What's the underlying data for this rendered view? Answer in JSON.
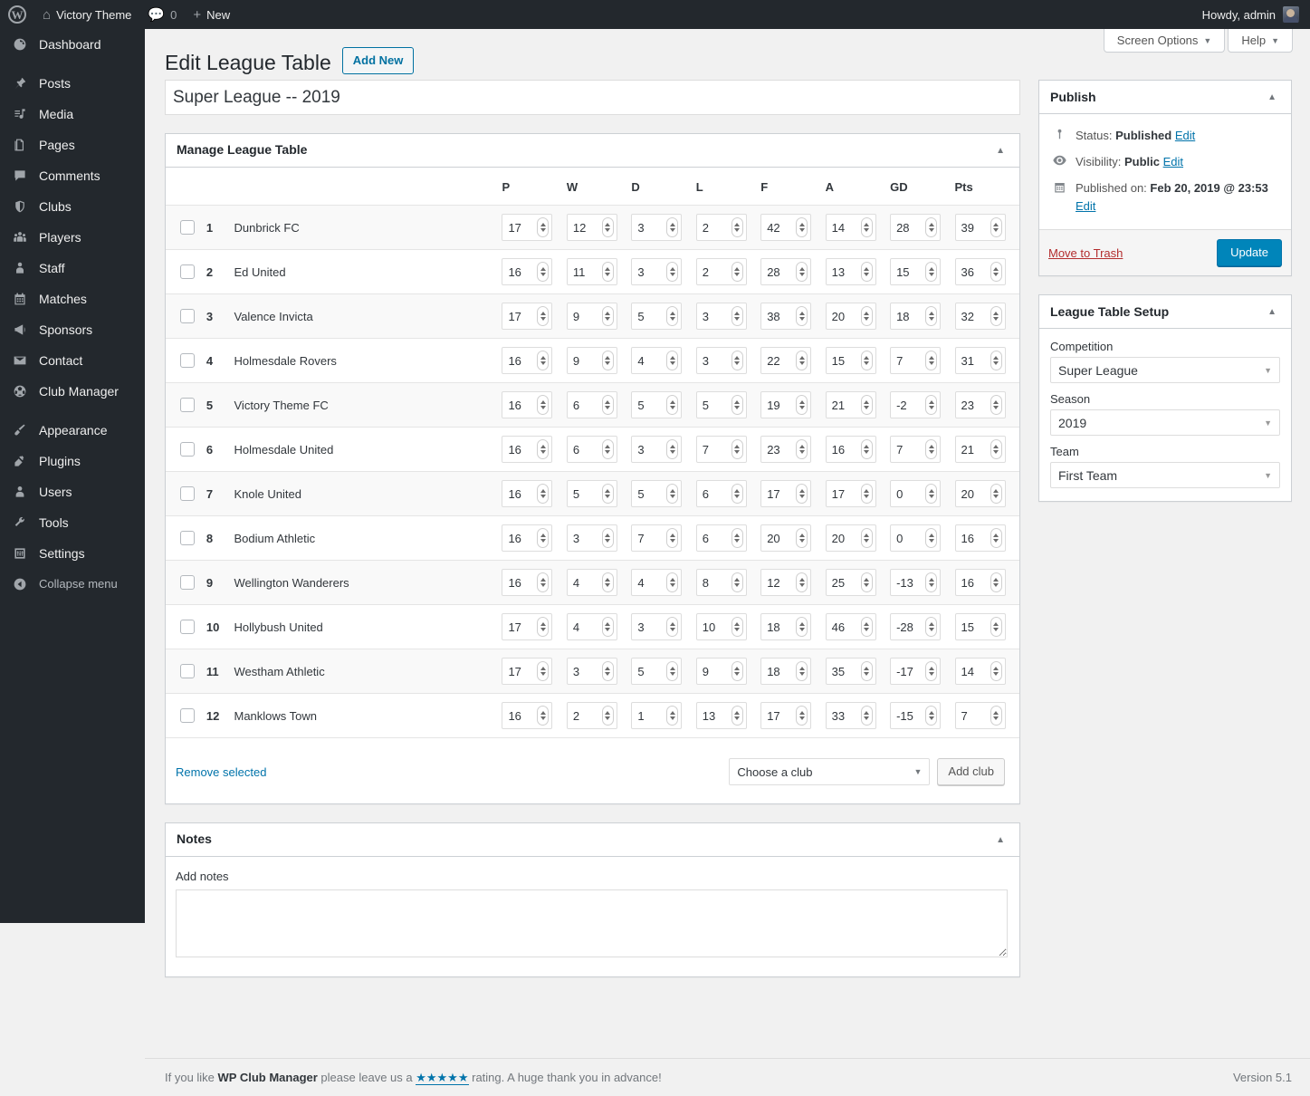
{
  "adminbar": {
    "wp_logo": "wordpress-logo-icon",
    "site_name": "Victory Theme",
    "comments_count": "0",
    "new_label": "New",
    "howdy": "Howdy, admin"
  },
  "sidebar": {
    "items": [
      {
        "label": "Dashboard",
        "icon": "dashboard-icon"
      },
      {
        "label": "Posts",
        "icon": "pin-icon"
      },
      {
        "label": "Media",
        "icon": "media-icon"
      },
      {
        "label": "Pages",
        "icon": "pages-icon"
      },
      {
        "label": "Comments",
        "icon": "comment-icon"
      },
      {
        "label": "Clubs",
        "icon": "shield-icon"
      },
      {
        "label": "Players",
        "icon": "players-icon"
      },
      {
        "label": "Staff",
        "icon": "staff-icon"
      },
      {
        "label": "Matches",
        "icon": "calendar-icon"
      },
      {
        "label": "Sponsors",
        "icon": "megaphone-icon"
      },
      {
        "label": "Contact",
        "icon": "envelope-icon"
      },
      {
        "label": "Club Manager",
        "icon": "football-icon"
      },
      {
        "label": "Appearance",
        "icon": "brush-icon"
      },
      {
        "label": "Plugins",
        "icon": "plug-icon"
      },
      {
        "label": "Users",
        "icon": "user-icon"
      },
      {
        "label": "Tools",
        "icon": "wrench-icon"
      },
      {
        "label": "Settings",
        "icon": "settings-icon"
      }
    ],
    "collapse_label": "Collapse menu"
  },
  "screen_meta": {
    "screen_options": "Screen Options",
    "help": "Help"
  },
  "page": {
    "title": "Edit League Table",
    "add_new": "Add New",
    "post_title_value": "Super League -- 2019",
    "post_title_placeholder": "Enter title here"
  },
  "manage_box": {
    "heading": "Manage League Table",
    "columns": [
      "P",
      "W",
      "D",
      "L",
      "F",
      "A",
      "GD",
      "Pts"
    ],
    "rows": [
      {
        "pos": "1",
        "club": "Dunbrick FC",
        "stats": [
          "17",
          "12",
          "3",
          "2",
          "42",
          "14",
          "28",
          "39"
        ]
      },
      {
        "pos": "2",
        "club": "Ed United",
        "stats": [
          "16",
          "11",
          "3",
          "2",
          "28",
          "13",
          "15",
          "36"
        ]
      },
      {
        "pos": "3",
        "club": "Valence Invicta",
        "stats": [
          "17",
          "9",
          "5",
          "3",
          "38",
          "20",
          "18",
          "32"
        ]
      },
      {
        "pos": "4",
        "club": "Holmesdale Rovers",
        "stats": [
          "16",
          "9",
          "4",
          "3",
          "22",
          "15",
          "7",
          "31"
        ]
      },
      {
        "pos": "5",
        "club": "Victory Theme FC",
        "stats": [
          "16",
          "6",
          "5",
          "5",
          "19",
          "21",
          "-2",
          "23"
        ]
      },
      {
        "pos": "6",
        "club": "Holmesdale United",
        "stats": [
          "16",
          "6",
          "3",
          "7",
          "23",
          "16",
          "7",
          "21"
        ]
      },
      {
        "pos": "7",
        "club": "Knole United",
        "stats": [
          "16",
          "5",
          "5",
          "6",
          "17",
          "17",
          "0",
          "20"
        ]
      },
      {
        "pos": "8",
        "club": "Bodium Athletic",
        "stats": [
          "16",
          "3",
          "7",
          "6",
          "20",
          "20",
          "0",
          "16"
        ]
      },
      {
        "pos": "9",
        "club": "Wellington Wanderers",
        "stats": [
          "16",
          "4",
          "4",
          "8",
          "12",
          "25",
          "-13",
          "16"
        ]
      },
      {
        "pos": "10",
        "club": "Hollybush United",
        "stats": [
          "17",
          "4",
          "3",
          "10",
          "18",
          "46",
          "-28",
          "15"
        ]
      },
      {
        "pos": "11",
        "club": "Westham Athletic",
        "stats": [
          "17",
          "3",
          "5",
          "9",
          "18",
          "35",
          "-17",
          "14"
        ]
      },
      {
        "pos": "12",
        "club": "Manklows Town",
        "stats": [
          "16",
          "2",
          "1",
          "13",
          "17",
          "33",
          "-15",
          "7"
        ]
      }
    ],
    "remove_selected": "Remove selected",
    "choose_club": "Choose a club",
    "add_club": "Add club"
  },
  "notes_box": {
    "heading": "Notes",
    "label": "Add notes",
    "value": "",
    "placeholder": ""
  },
  "publish_box": {
    "heading": "Publish",
    "status_label": "Status:",
    "status_value": "Published",
    "status_edit": "Edit",
    "visibility_label": "Visibility:",
    "visibility_value": "Public",
    "visibility_edit": "Edit",
    "published_label": "Published on:",
    "published_value": "Feb 20, 2019 @ 23:53",
    "published_edit": "Edit",
    "trash": "Move to Trash",
    "update": "Update"
  },
  "setup_box": {
    "heading": "League Table Setup",
    "competition_label": "Competition",
    "competition_value": "Super League",
    "season_label": "Season",
    "season_value": "2019",
    "team_label": "Team",
    "team_value": "First Team"
  },
  "footer": {
    "prefix": "If you like ",
    "plugin": "WP Club Manager",
    "middle": " please leave us a ",
    "stars": "★★★★★",
    "suffix": " rating. A huge thank you in advance!",
    "version": "Version 5.1"
  },
  "colors": {
    "admin_bar": "#23282d",
    "sidebar": "#23282d",
    "accent_blue": "#0073aa",
    "primary_button": "#0085ba",
    "trash_red": "#b32d2e",
    "page_bg": "#f1f1f1"
  }
}
